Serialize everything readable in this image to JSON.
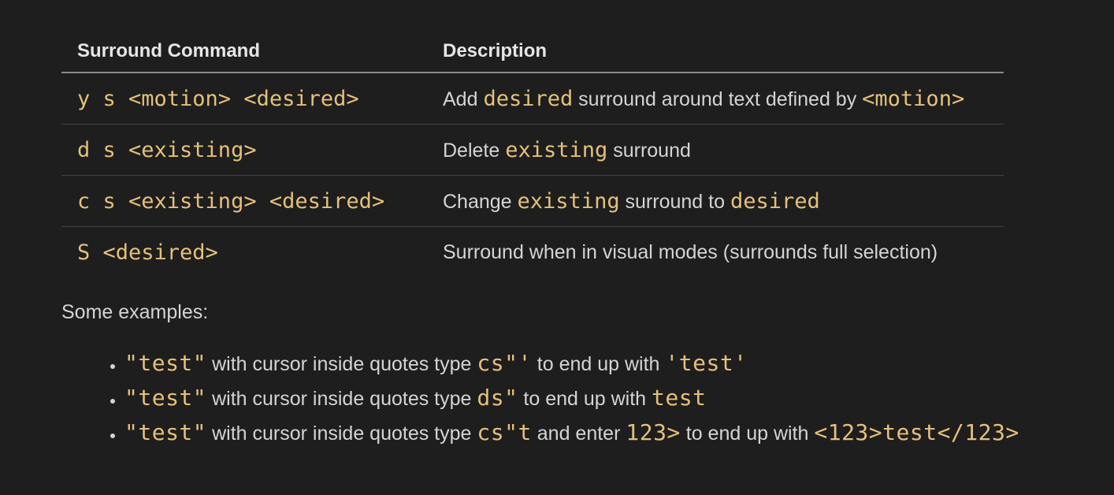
{
  "table": {
    "headers": [
      "Surround Command",
      "Description"
    ],
    "rows": [
      {
        "command": "y s <motion> <desired>",
        "desc": [
          {
            "t": "Add ",
            "code": false
          },
          {
            "t": "desired",
            "code": true
          },
          {
            "t": " surround around text defined by ",
            "code": false
          },
          {
            "t": "<motion>",
            "code": true
          }
        ]
      },
      {
        "command": "d s <existing>",
        "desc": [
          {
            "t": "Delete ",
            "code": false
          },
          {
            "t": "existing",
            "code": true
          },
          {
            "t": " surround",
            "code": false
          }
        ]
      },
      {
        "command": "c s <existing> <desired>",
        "desc": [
          {
            "t": "Change ",
            "code": false
          },
          {
            "t": "existing",
            "code": true
          },
          {
            "t": " surround to ",
            "code": false
          },
          {
            "t": "desired",
            "code": true
          }
        ]
      },
      {
        "command": "S <desired>",
        "desc": [
          {
            "t": "Surround when in visual modes (surrounds full selection)",
            "code": false
          }
        ]
      }
    ]
  },
  "examples_intro": "Some examples:",
  "examples": [
    [
      {
        "t": "\"test\"",
        "code": true
      },
      {
        "t": " with cursor inside quotes type ",
        "code": false
      },
      {
        "t": "cs\"'",
        "code": true
      },
      {
        "t": " to end up with ",
        "code": false
      },
      {
        "t": "'test'",
        "code": true
      }
    ],
    [
      {
        "t": "\"test\"",
        "code": true
      },
      {
        "t": " with cursor inside quotes type ",
        "code": false
      },
      {
        "t": "ds\"",
        "code": true
      },
      {
        "t": " to end up with ",
        "code": false
      },
      {
        "t": "test",
        "code": true
      }
    ],
    [
      {
        "t": "\"test\"",
        "code": true
      },
      {
        "t": " with cursor inside quotes type ",
        "code": false
      },
      {
        "t": "cs\"t",
        "code": true
      },
      {
        "t": " and enter ",
        "code": false
      },
      {
        "t": "123>",
        "code": true
      },
      {
        "t": " to end up with ",
        "code": false
      },
      {
        "t": "<123>test</123>",
        "code": true
      }
    ]
  ],
  "colors": {
    "background": "#1e1e1e",
    "text": "#d4d4d4",
    "code": "#e5c07b"
  }
}
